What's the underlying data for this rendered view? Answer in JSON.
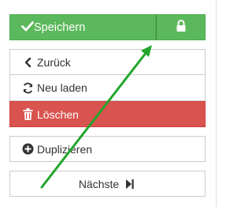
{
  "save_group": {
    "save_label": "Speichern",
    "save_icon": "check-icon",
    "lock_icon": "lock-icon"
  },
  "buttons": {
    "back": {
      "label": "Zurück",
      "icon": "chevron-left-icon"
    },
    "reload": {
      "label": "Neu laden",
      "icon": "refresh-icon"
    },
    "delete": {
      "label": "Löschen",
      "icon": "trash-icon"
    },
    "duplicate": {
      "label": "Duplizieren",
      "icon": "plus-circle-icon"
    },
    "next": {
      "label": "Nächste",
      "icon": "step-forward-icon"
    }
  },
  "annotation": {
    "icon": "arrow-annotation",
    "color": "#22a52a"
  },
  "colors": {
    "success": "#5cb85c",
    "danger": "#d9534f",
    "border": "#cccccc",
    "text": "#333333"
  }
}
